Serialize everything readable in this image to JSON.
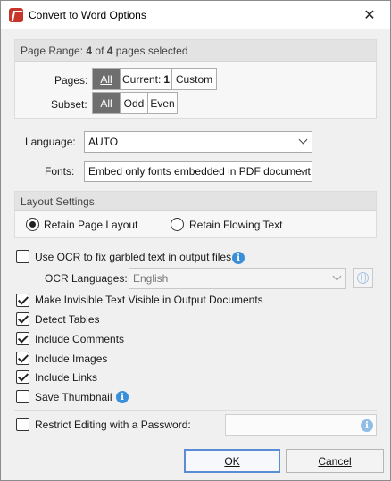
{
  "window": {
    "title": "Convert to Word Options",
    "close_glyph": "✕"
  },
  "page_range": {
    "header_prefix": "Page Range: ",
    "current": "4",
    "of_text": " of ",
    "total": "4",
    "suffix": " pages selected",
    "pages_label": "Pages:",
    "pages_options": {
      "all": "All",
      "current": "Current: ",
      "current_num": "1",
      "custom": "Custom"
    },
    "pages_selected": "All",
    "subset_label": "Subset:",
    "subset_options": {
      "all": "All",
      "odd": "Odd",
      "even": "Even"
    },
    "subset_selected": "All"
  },
  "language": {
    "label": "Language:",
    "value": "AUTO"
  },
  "fonts": {
    "label": "Fonts:",
    "value": "Embed only fonts embedded in PDF document"
  },
  "layout": {
    "header": "Layout Settings",
    "retain_page": "Retain Page Layout",
    "retain_flowing": "Retain Flowing Text",
    "selected": "Retain Page Layout"
  },
  "ocr": {
    "label": "Use OCR to fix garbled text in output files",
    "checked": false,
    "languages_label": "OCR Languages:",
    "languages_value": "English"
  },
  "options": [
    {
      "label": "Make Invisible Text Visible in Output Documents",
      "checked": true
    },
    {
      "label": "Detect Tables",
      "checked": true
    },
    {
      "label": "Include Comments",
      "checked": true
    },
    {
      "label": "Include Images",
      "checked": true
    },
    {
      "label": "Include Links",
      "checked": true
    },
    {
      "label": "Save Thumbnail",
      "checked": false
    }
  ],
  "restrict": {
    "label": "Restrict Editing with a Password:",
    "checked": false,
    "value": ""
  },
  "buttons": {
    "ok": "OK",
    "cancel": "Cancel"
  },
  "icons": {
    "info": "info-icon",
    "globe": "globe-icon",
    "app": "pdf-app-icon"
  },
  "colors": {
    "segment_active": "#6e6e6e",
    "info_blue": "#3b8fd8",
    "default_button_border": "#5b8cd6"
  }
}
